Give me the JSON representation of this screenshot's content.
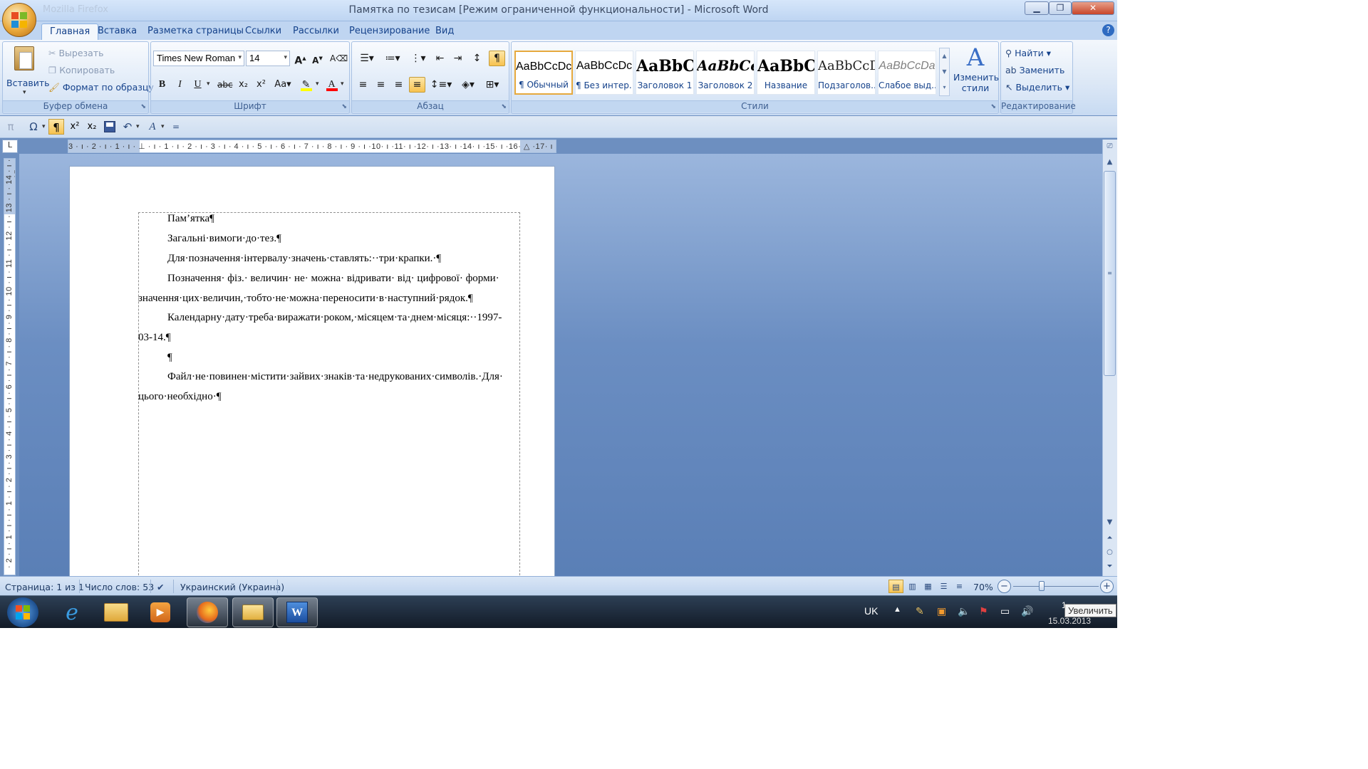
{
  "window": {
    "title": "Памятка  по тезисам [Режим ограниченной функциональности] - Microsoft Word",
    "ghost_title": "Mozilla Firefox",
    "buttons": [
      "▁",
      "❐",
      "✕"
    ],
    "help": "?"
  },
  "tabs": [
    "Главная",
    "Вставка",
    "Разметка страницы",
    "Ссылки",
    "Рассылки",
    "Рецензирование",
    "Вид"
  ],
  "clipboard": {
    "paste": "Вставить",
    "cut": "Вырезать",
    "copy": "Копировать",
    "format_painter": "Формат по образцу",
    "label": "Буфер обмена"
  },
  "font": {
    "name": "Times New Roman",
    "size": "14",
    "label": "Шрифт",
    "highlight_color": "#ffff00",
    "font_color": "#ff0000"
  },
  "paragraph": {
    "label": "Абзац"
  },
  "styles": {
    "label": "Стили",
    "items": [
      {
        "preview": "AaBbCcDc",
        "name": "¶ Обычный"
      },
      {
        "preview": "AaBbCcDc",
        "name": "¶ Без интер..."
      },
      {
        "preview": "AaBbC",
        "name": "Заголовок 1"
      },
      {
        "preview": "AaBbCc",
        "name": "Заголовок 2"
      },
      {
        "preview": "AaBbC",
        "name": "Название"
      },
      {
        "preview": "AaBbCcD",
        "name": "Подзаголов..."
      },
      {
        "preview": "AaBbCcDa",
        "name": "Слабое выд..."
      }
    ],
    "change": "Изменить стили"
  },
  "editing": {
    "find": "Найти",
    "replace": "Заменить",
    "select": "Выделить",
    "label": "Редактирование"
  },
  "qat": [
    "π",
    "Ω",
    "¶",
    "x²",
    "x₂",
    "save",
    "undo",
    "A",
    "="
  ],
  "ruler": {
    "tab_marker": "L",
    "h_labels": "3 · ı · 2 · ı · 1 · ı · ⊥ · ı · 1 · ı · 2 · ı · 3 · ı · 4 · ı · 5 · ı · 6 · ı · 7 · ı · 8 · ı · 9 · ı ·10· ı ·11· ı ·12· ı ·13· ı ·14· ı ·15· ı ·16· △ ·17· ı ·",
    "v_labels": "· 2 · ı · 1 · ı · ı · 1 · ı · 2 · ı · 3 · ı · 4 · ı · 5 · ı · 6 · ı · 7 · ı · 8 · ı · 9 · ı · 10 · ı · 11 · ı · 12 · ı · 13 · ı · 14 · ı · 15 · ı"
  },
  "document": {
    "paragraphs": [
      "Пам’ятка¶",
      "Загальні·вимоги·до·тез.¶",
      "Для·позначення·інтервалу·значень·ставлять:··три·крапки.·¶",
      "Позначення· фіз.· величин· не· можна· відривати· від· цифрової· форми·",
      "значення·цих·величин,·тобто·не·можна·переносити·в·наступний·рядок.¶",
      "Календарну·дату·треба·виражати·роком,·місяцем·та·днем·місяця:··1997-",
      "03-14.¶",
      "¶",
      "Файл·не·повинен·містити·зайвих·знаків·та·недрукованих·символів.·Для·",
      "цього·необхідно·¶"
    ]
  },
  "status": {
    "page": "Страница: 1 из 1",
    "words": "Число слов: 53",
    "language": "Украинский (Украина)",
    "zoom": "70%",
    "zoom_level": 0.7
  },
  "taskbar": {
    "lang": "UK",
    "tooltip": "Увеличить",
    "date": "15.03.2013",
    "time_fragment": "1"
  }
}
